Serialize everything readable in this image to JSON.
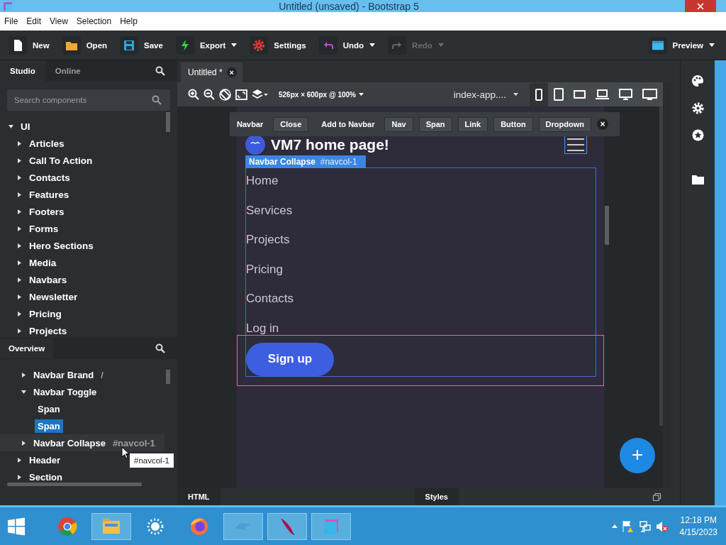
{
  "window": {
    "title": "Untitled (unsaved) - Bootstrap 5"
  },
  "menu": [
    "File",
    "Edit",
    "View",
    "Selection",
    "Help"
  ],
  "toolbar": [
    {
      "label": "New",
      "dropdown": false,
      "disabled": false
    },
    {
      "label": "Open",
      "dropdown": false,
      "disabled": false
    },
    {
      "label": "Save",
      "dropdown": false,
      "disabled": false
    },
    {
      "label": "Export",
      "dropdown": true,
      "disabled": false
    },
    {
      "label": "Settings",
      "dropdown": false,
      "disabled": false
    },
    {
      "label": "Undo",
      "dropdown": true,
      "disabled": false
    },
    {
      "label": "Redo",
      "dropdown": true,
      "disabled": true
    }
  ],
  "preview_button": {
    "label": "Preview"
  },
  "left_tabs": [
    {
      "label": "Studio",
      "selected": true
    },
    {
      "label": "Online",
      "selected": false
    }
  ],
  "search": {
    "placeholder": "Search components"
  },
  "components": [
    {
      "label": "UI",
      "expanded": true,
      "children": [
        {
          "label": "Articles",
          "expanded": false
        },
        {
          "label": "Call To Action",
          "expanded": false
        },
        {
          "label": "Contacts",
          "expanded": false
        },
        {
          "label": "Features",
          "expanded": false
        },
        {
          "label": "Footers",
          "expanded": false
        },
        {
          "label": "Forms",
          "expanded": false
        },
        {
          "label": "Hero Sections",
          "expanded": false
        },
        {
          "label": "Media",
          "expanded": false
        },
        {
          "label": "Navbars",
          "expanded": false
        },
        {
          "label": "Newsletter",
          "expanded": false
        },
        {
          "label": "Pricing",
          "expanded": false
        },
        {
          "label": "Projects",
          "expanded": false
        }
      ]
    }
  ],
  "overview": {
    "title": "Overview",
    "items": [
      {
        "children": [
          {
            "label": "Navbar Brand",
            "suffix": "/",
            "expanded": false,
            "selected": false
          },
          {
            "label": "Navbar Toggle",
            "expanded": true,
            "selected": false,
            "children": [
              {
                "label": "Span",
                "selected": false
              },
              {
                "label": "Span",
                "selected": true
              }
            ]
          },
          {
            "label": "Navbar Collapse",
            "suffix": "#navcol-1",
            "expanded": false,
            "selected": false,
            "hovered": true
          }
        ]
      },
      {
        "label": "Header",
        "expanded": false,
        "selected": false
      },
      {
        "label": "Section",
        "expanded": false,
        "selected": false
      }
    ],
    "tooltip": "#navcol-1"
  },
  "doc_tab": {
    "label": "Untitled *",
    "close": "×"
  },
  "canvas_toolbar": {
    "size": "526px × 600px @ 100%",
    "page": "index-app...."
  },
  "navbar_toolbar": {
    "title": "Navbar",
    "items": [
      {
        "kind": "button",
        "label": "Close"
      },
      {
        "kind": "label",
        "label": "Add to Navbar"
      },
      {
        "kind": "button",
        "label": "Nav"
      },
      {
        "kind": "button",
        "label": "Span"
      },
      {
        "kind": "button",
        "label": "Link"
      },
      {
        "kind": "button",
        "label": "Button"
      },
      {
        "kind": "button",
        "label": "Dropdown"
      }
    ],
    "close": "×"
  },
  "preview": {
    "brand": "VM7 home page!",
    "tag": {
      "name": "Navbar Collapse",
      "id": "#navcol-1"
    },
    "links": [
      "Home",
      "Services",
      "Projects",
      "Pricing",
      "Contacts",
      "Log in"
    ],
    "button": "Sign up"
  },
  "fab": "+",
  "bottom_tabs": [
    "HTML",
    "Styles"
  ],
  "taskbar": {
    "apps": [
      {
        "active": false
      },
      {
        "active": true
      },
      {
        "active": false
      },
      {
        "active": false
      },
      {
        "active": true
      },
      {
        "active": true
      },
      {
        "active": true
      }
    ],
    "time": "12:18 PM",
    "date": "4/15/2023"
  }
}
